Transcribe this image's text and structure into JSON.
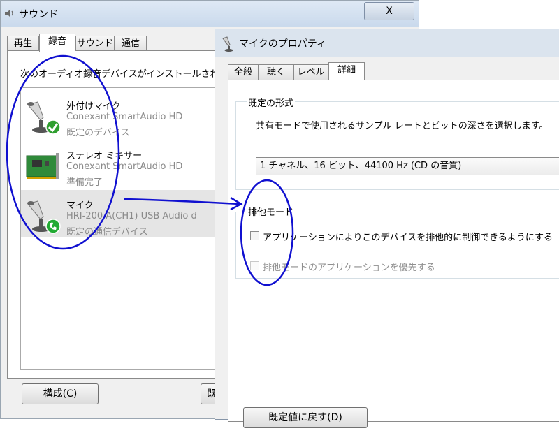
{
  "sound_window": {
    "title": "サウンド",
    "close_label": "X",
    "tabs": [
      {
        "label": "再生"
      },
      {
        "label": "録音"
      },
      {
        "label": "サウンド"
      },
      {
        "label": "通信"
      }
    ],
    "description": "次のオーディオ録音デバイスがインストールされてい",
    "devices": [
      {
        "name": "外付けマイク",
        "driver": "Conexant SmartAudio HD",
        "status": "既定のデバイス"
      },
      {
        "name": "ステレオ ミキサー",
        "driver": "Conexant SmartAudio HD",
        "status": "準備完了"
      },
      {
        "name": "マイク",
        "driver": "HRI-200 A(CH1) USB Audio d",
        "status": "既定の通信デバイス"
      }
    ],
    "configure_button": "構成(C)",
    "default_button_partial": "既"
  },
  "mic_window": {
    "title": "マイクのプロパティ",
    "tabs": [
      {
        "label": "全般"
      },
      {
        "label": "聴く"
      },
      {
        "label": "レベル"
      },
      {
        "label": "詳細"
      }
    ],
    "default_format": {
      "group_label": "既定の形式",
      "description": "共有モードで使用されるサンプル レートとビットの深さを選択します。",
      "selected": "1 チャネル、16 ビット、44100 Hz (CD の音質)"
    },
    "exclusive_mode": {
      "group_label": "排他モード",
      "option_allow": "アプリケーションによりこのデバイスを排他的に制御できるようにする",
      "option_priority": "排他モードのアプリケーションを優先する"
    },
    "restore_button_partial": "既定値に戻す(D)"
  },
  "colors": {
    "annotation": "#1010d0",
    "check_green": "#2f9e2f",
    "phone_green": "#22aa33"
  }
}
